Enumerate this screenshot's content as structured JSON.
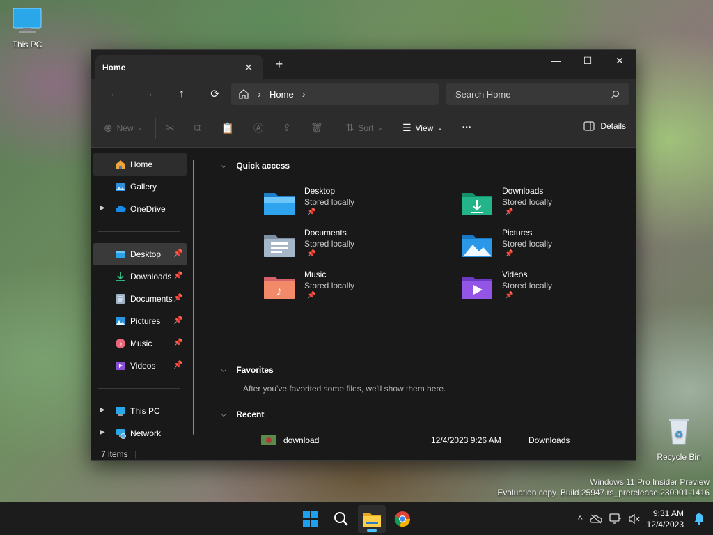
{
  "desktop": {
    "icons": [
      {
        "label": "This PC",
        "icon": "monitor-icon"
      },
      {
        "label": "Recycle Bin",
        "icon": "recycle-bin-icon"
      }
    ],
    "watermark": {
      "line1": "Windows 11 Pro Insider Preview",
      "line2": "Evaluation copy. Build 25947.rs_prerelease.230901-1416"
    }
  },
  "window": {
    "tab_title": "Home",
    "tab_close": "✕",
    "new_tab": "+",
    "controls": {
      "minimize": "—",
      "maximize": "☐",
      "close": "✕"
    },
    "nav": {
      "back": "←",
      "forward": "→",
      "up": "↑",
      "refresh": "⟳"
    },
    "breadcrumb": {
      "location": "Home",
      "sep": "›"
    },
    "search_placeholder": "Search Home",
    "toolbar": {
      "new_label": "New",
      "sort_label": "Sort",
      "view_label": "View",
      "more_label": "•••",
      "details_label": "Details"
    },
    "sidebar": {
      "top_items": [
        {
          "label": "Home",
          "icon": "home-icon"
        },
        {
          "label": "Gallery",
          "icon": "gallery-icon"
        },
        {
          "label": "OneDrive",
          "icon": "onedrive-cloud-icon"
        }
      ],
      "pinned_items": [
        {
          "label": "Desktop",
          "icon": "desktop-folder-icon"
        },
        {
          "label": "Downloads",
          "icon": "download-icon"
        },
        {
          "label": "Documents",
          "icon": "documents-icon"
        },
        {
          "label": "Pictures",
          "icon": "pictures-icon"
        },
        {
          "label": "Music",
          "icon": "music-icon"
        },
        {
          "label": "Videos",
          "icon": "videos-icon"
        }
      ],
      "bottom_items": [
        {
          "label": "This PC",
          "icon": "monitor-icon"
        },
        {
          "label": "Network",
          "icon": "network-icon"
        }
      ],
      "pin_glyph": "📌"
    },
    "content": {
      "quick_access": {
        "title": "Quick access",
        "items": [
          {
            "name": "Desktop",
            "sub": "Stored locally"
          },
          {
            "name": "Downloads",
            "sub": "Stored locally"
          },
          {
            "name": "Documents",
            "sub": "Stored locally"
          },
          {
            "name": "Pictures",
            "sub": "Stored locally"
          },
          {
            "name": "Music",
            "sub": "Stored locally"
          },
          {
            "name": "Videos",
            "sub": "Stored locally"
          }
        ]
      },
      "favorites": {
        "title": "Favorites",
        "empty_message": "After you've favorited some files, we'll show them here."
      },
      "recent": {
        "title": "Recent",
        "items": [
          {
            "name": "download",
            "date": "12/4/2023 9:26 AM",
            "location": "Downloads"
          }
        ]
      }
    },
    "status": {
      "items": "7 items"
    }
  },
  "taskbar": {
    "apps": [
      "start-icon",
      "search-icon",
      "file-explorer-icon",
      "chrome-icon"
    ],
    "clock": {
      "time": "9:31 AM",
      "date": "12/4/2023"
    },
    "tray_chevron": "^"
  },
  "colors": {
    "accent": "#4cc2ff",
    "window_bg": "#191919",
    "toolbar_bg": "#2c2c2c"
  }
}
